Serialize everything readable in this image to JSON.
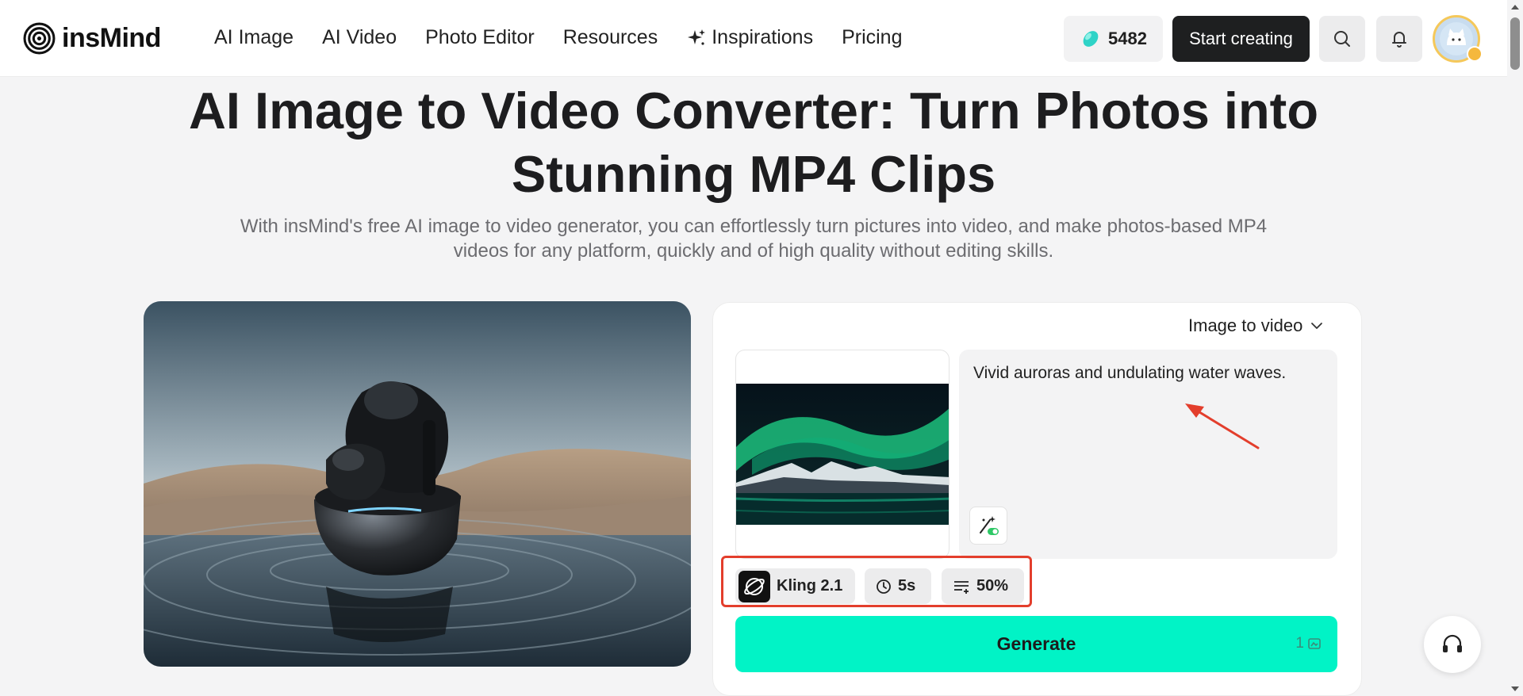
{
  "header": {
    "logo_text": "insMind",
    "nav": [
      {
        "label": "AI Image"
      },
      {
        "label": "AI Video"
      },
      {
        "label": "Photo Editor"
      },
      {
        "label": "Resources"
      },
      {
        "label": "Inspirations",
        "icon": "sparkle-icon"
      },
      {
        "label": "Pricing"
      }
    ],
    "credits": "5482",
    "start_label": "Start creating",
    "icons": [
      "search-icon",
      "bell-icon",
      "avatar"
    ]
  },
  "hero": {
    "title_line1": "AI Image to Video Converter: Turn Photos into",
    "title_line2": "Stunning MP4 Clips",
    "subtitle_line1": "With insMind's free AI image to video generator, you can effortlessly turn pictures into video, and make photos-based MP4",
    "subtitle_line2": "videos for any platform, quickly and of high quality without editing skills."
  },
  "panel": {
    "mode": "Image to video",
    "prompt": "Vivid auroras and undulating water waves.",
    "options": {
      "model": "Kling 2.1",
      "duration": "5s",
      "strength": "50%"
    },
    "generate_label": "Generate",
    "generate_cost": "1"
  },
  "colors": {
    "accent": "#01f3c6",
    "highlight": "#e33e2c",
    "dark_button": "#1e1f20"
  }
}
